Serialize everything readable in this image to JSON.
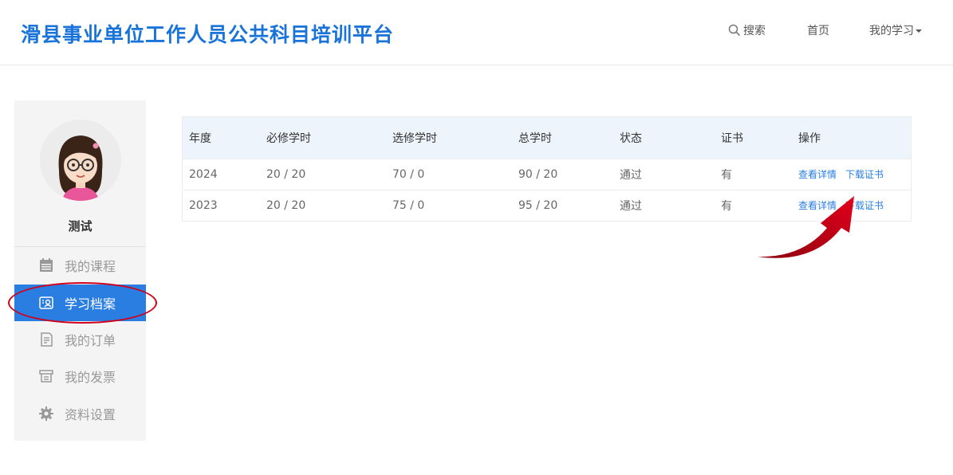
{
  "header": {
    "title": "滑县事业单位工作人员公共科目培训平台",
    "nav": {
      "search_label": "搜索",
      "home_label": "首页",
      "my_study_label": "我的学习"
    }
  },
  "sidebar": {
    "user_name": "测试",
    "items": [
      {
        "label": "我的课程",
        "icon": "calendar-icon",
        "active": false
      },
      {
        "label": "学习档案",
        "icon": "profile-card-icon",
        "active": true
      },
      {
        "label": "我的订单",
        "icon": "document-icon",
        "active": false
      },
      {
        "label": "我的发票",
        "icon": "invoice-icon",
        "active": false
      },
      {
        "label": "资料设置",
        "icon": "gear-icon",
        "active": false
      }
    ]
  },
  "table": {
    "headers": [
      "年度",
      "必修学时",
      "选修学时",
      "总学时",
      "状态",
      "证书",
      "操作"
    ],
    "rows": [
      {
        "year": "2024",
        "required": "20 / 20",
        "elective": "70 / 0",
        "total": "90 / 20",
        "status": "通过",
        "certificate": "有",
        "view_label": "查看详情",
        "download_label": "下载证书"
      },
      {
        "year": "2023",
        "required": "20 / 20",
        "elective": "75 / 0",
        "total": "95 / 20",
        "status": "通过",
        "certificate": "有",
        "view_label": "查看详情",
        "download_label": "下载证书"
      }
    ]
  },
  "colors": {
    "title_blue": "#1a73d9",
    "active_blue": "#2a7de1",
    "annotation_red": "#d0021b"
  }
}
